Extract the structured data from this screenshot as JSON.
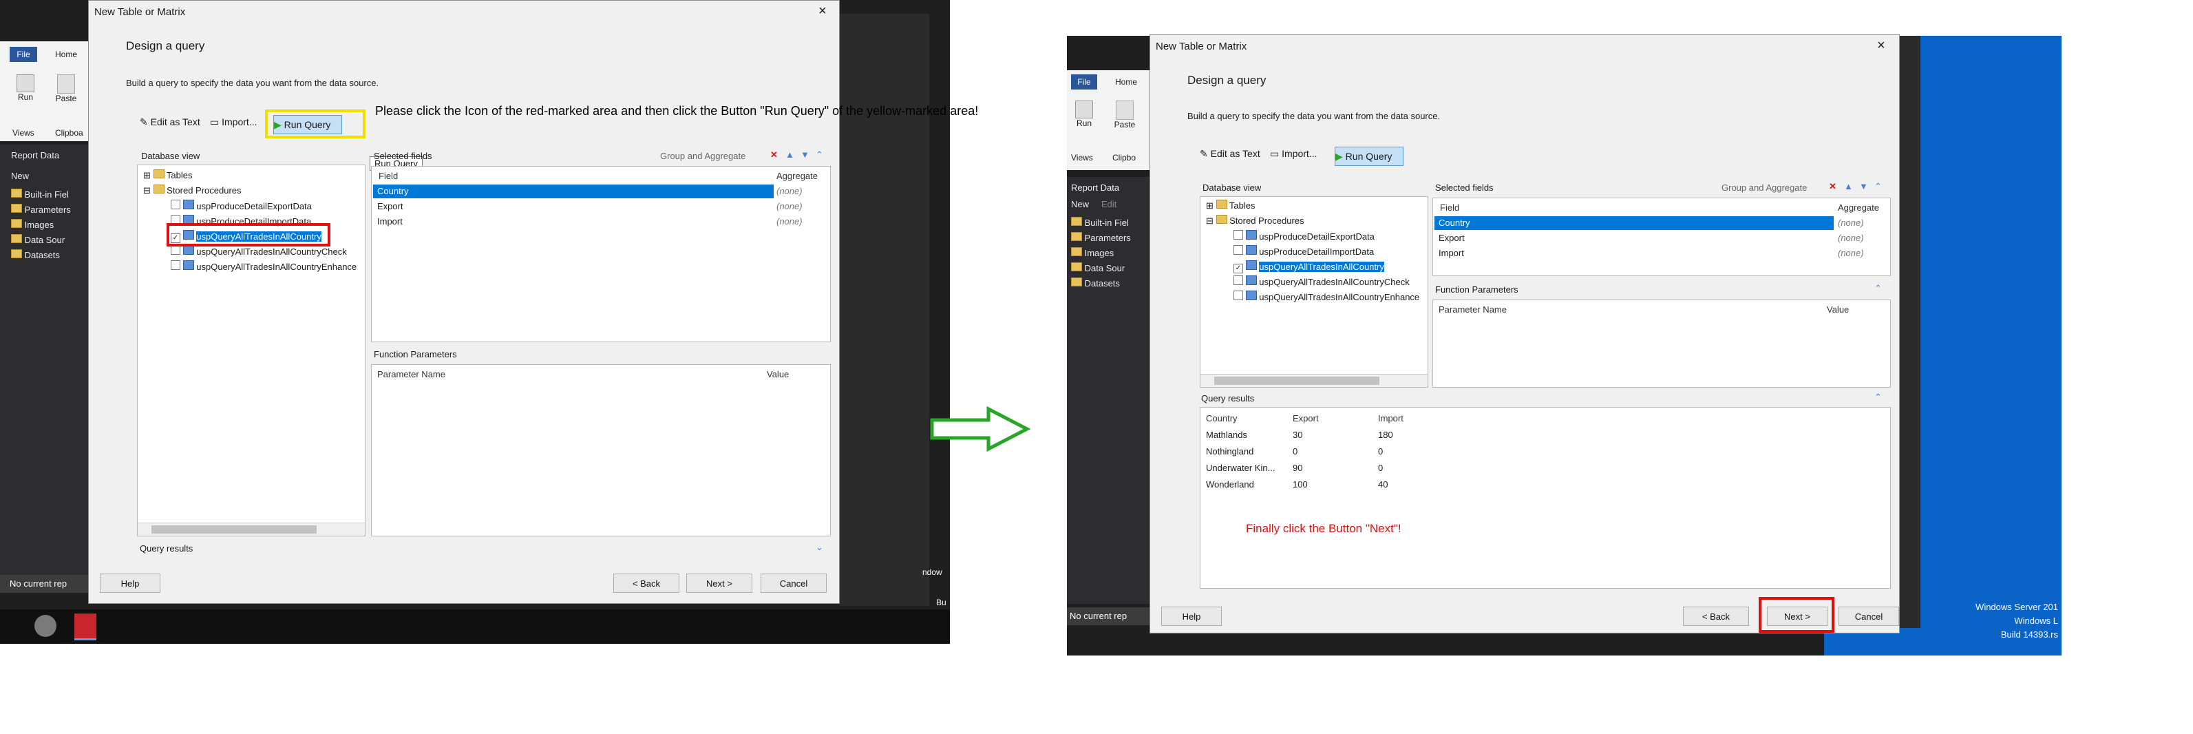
{
  "left": {
    "taskbar_tab": "New",
    "report_data_title": "Report Data",
    "ribbon": {
      "file": "File",
      "home": "Home",
      "run": "Run",
      "paste": "Paste",
      "views": "Views",
      "clipboard": "Clipboa"
    },
    "side_items": [
      "Built-in Fiel",
      "Parameters",
      "Images",
      "Data Sour",
      "Datasets"
    ],
    "status": "No current rep",
    "right_edge_text": [
      "ndow",
      "Bu"
    ],
    "dialog": {
      "title": "New Table or Matrix",
      "heading": "Design a query",
      "subheading": "Build a query to specify the data you want from the data source.",
      "toolbar": {
        "edit_as_text": "Edit as Text",
        "import": "Import...",
        "run_query": "Run Query",
        "tooltip": "Run Query"
      },
      "instruction": "Please click the Icon of the red-marked area and then click the Button \"Run Query\" of the yellow-marked area!",
      "database_view": "Database view",
      "tree": {
        "tables": "Tables",
        "stored_procedures": "Stored Procedures",
        "procs": [
          "uspProduceDetailExportData",
          "uspProduceDetailImportData",
          "uspQueryAllTradesInAllCountry",
          "uspQueryAllTradesInAllCountryCheck",
          "uspQueryAllTradesInAllCountryEnhance"
        ]
      },
      "selected_fields": "Selected fields",
      "group_aggregate": "Group and Aggregate",
      "fields_header": {
        "field": "Field",
        "aggregate": "Aggregate"
      },
      "fields": [
        {
          "field": "Country",
          "aggregate": "(none)"
        },
        {
          "field": "Export",
          "aggregate": "(none)"
        },
        {
          "field": "Import",
          "aggregate": "(none)"
        }
      ],
      "function_parameters": "Function Parameters",
      "param_header": {
        "name": "Parameter Name",
        "value": "Value"
      },
      "query_results": "Query results",
      "buttons": {
        "help": "Help",
        "back": "< Back",
        "next": "Next >",
        "cancel": "Cancel"
      }
    }
  },
  "right": {
    "taskbar_tab": "New",
    "taskbar_tab2": "Edit",
    "report_data_title": "Report Data",
    "ribbon": {
      "file": "File",
      "home": "Home",
      "run": "Run",
      "paste": "Paste",
      "views": "Views",
      "clipboard": "Clipbo"
    },
    "side_items": [
      "Built-in Fiel",
      "Parameters",
      "Images",
      "Data Sour",
      "Datasets"
    ],
    "status": "No current rep",
    "windows_text": [
      "Windows Server 201",
      "Windows L",
      "Build 14393.rs"
    ],
    "dialog": {
      "title": "New Table or Matrix",
      "heading": "Design a query",
      "subheading": "Build a query to specify the data you want from the data source.",
      "toolbar": {
        "edit_as_text": "Edit as Text",
        "import": "Import...",
        "run_query": "Run Query"
      },
      "database_view": "Database view",
      "tree": {
        "tables": "Tables",
        "stored_procedures": "Stored Procedures",
        "procs": [
          "uspProduceDetailExportData",
          "uspProduceDetailImportData",
          "uspQueryAllTradesInAllCountry",
          "uspQueryAllTradesInAllCountryCheck",
          "uspQueryAllTradesInAllCountryEnhance"
        ]
      },
      "selected_fields": "Selected fields",
      "group_aggregate": "Group and Aggregate",
      "fields_header": {
        "field": "Field",
        "aggregate": "Aggregate"
      },
      "fields": [
        {
          "field": "Country",
          "aggregate": "(none)"
        },
        {
          "field": "Export",
          "aggregate": "(none)"
        },
        {
          "field": "Import",
          "aggregate": "(none)"
        }
      ],
      "function_parameters": "Function Parameters",
      "param_header": {
        "name": "Parameter Name",
        "value": "Value"
      },
      "query_results": "Query results",
      "results_header": [
        "Country",
        "Export",
        "Import"
      ],
      "results": [
        [
          "Mathlands",
          "30",
          "180"
        ],
        [
          "Nothingland",
          "0",
          "0"
        ],
        [
          "Underwater Kin...",
          "90",
          "0"
        ],
        [
          "Wonderland",
          "100",
          "40"
        ]
      ],
      "final_note": "Finally click the Button \"Next\"!",
      "buttons": {
        "help": "Help",
        "back": "< Back",
        "next": "Next >",
        "cancel": "Cancel"
      }
    }
  },
  "colors": {
    "highlight_red": "#e01010",
    "highlight_yellow": "#f0e000",
    "arrow_green": "#2aa52a",
    "selection": "#0078d7"
  }
}
